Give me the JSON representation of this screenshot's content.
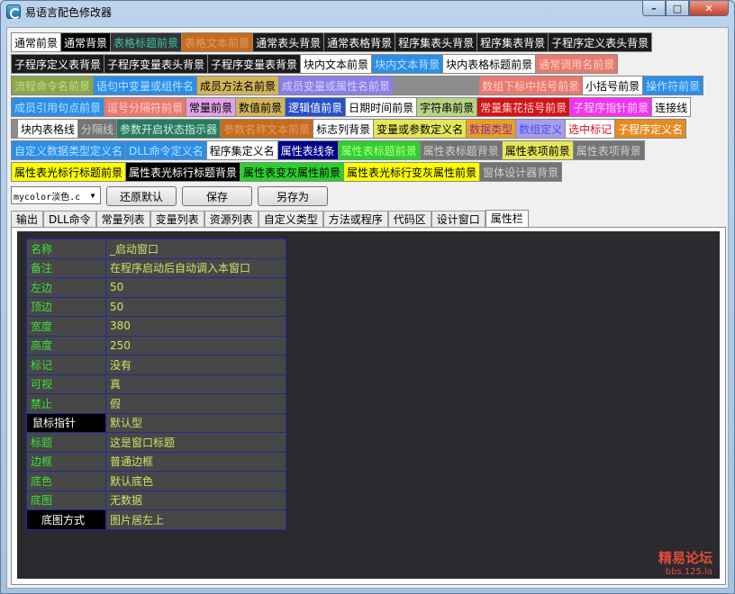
{
  "window": {
    "title": "易语言配色修改器",
    "min": "–",
    "max": "□",
    "close": "✕"
  },
  "swatch_rows": [
    [
      {
        "label": "通常前景",
        "bg": "#ffffff",
        "fg": "#000000"
      },
      {
        "label": "通常背景",
        "bg": "#000000",
        "fg": "#ffffff"
      },
      {
        "label": "表格标题前景",
        "bg": "#333333",
        "fg": "#3cc7a8"
      },
      {
        "label": "表格文本前景",
        "bg": "#c86b1a",
        "fg": "#d8a070"
      },
      {
        "label": "通常表头背景",
        "bg": "#1b1b1b",
        "fg": "#ffffff"
      },
      {
        "label": "通常表格背景",
        "bg": "#1b1b1b",
        "fg": "#ffffff"
      },
      {
        "label": "程序集表头背景",
        "bg": "#1b1b1b",
        "fg": "#ffffff"
      },
      {
        "label": "程序集表背景",
        "bg": "#1b1b1b",
        "fg": "#ffffff"
      },
      {
        "label": "子程序定义表头背景",
        "bg": "#1b1b1b",
        "fg": "#ffffff"
      }
    ],
    [
      {
        "label": "子程序定义表背景",
        "bg": "#1b1b1b",
        "fg": "#ffffff"
      },
      {
        "label": "子程序变量表头背景",
        "bg": "#1b1b1b",
        "fg": "#ffffff"
      },
      {
        "label": "子程序变量表背景",
        "bg": "#1b1b1b",
        "fg": "#ffffff"
      },
      {
        "label": "块内文本前景",
        "bg": "#ffffff",
        "fg": "#000000"
      },
      {
        "label": "块内文本背景",
        "bg": "#2c8ee8",
        "fg": "#b9e1ff"
      },
      {
        "label": "块内表格标题前景",
        "bg": "#ffffff",
        "fg": "#000000"
      },
      {
        "label": "通常调用名前景",
        "bg": "#e87a6e",
        "fg": "#ffd0cc"
      }
    ],
    [
      {
        "label": "流程命令名前景",
        "bg": "#8aa64a",
        "fg": "#c7da8f"
      },
      {
        "label": "语句中变量或组件名",
        "bg": "#2c8ee8",
        "fg": "#b9e1ff"
      },
      {
        "label": "成员方法名前景",
        "bg": "#d2b45c",
        "fg": "#000000"
      },
      {
        "label": "成员变量或属性名前景",
        "bg": "#8a7ee8",
        "fg": "#d7d1ff"
      },
      {
        "label": "",
        "bg": "#8c8c8c",
        "fg": "#000000"
      },
      {
        "label": "数组下标中括号前景",
        "bg": "#e87a6e",
        "fg": "#ffd0cc"
      },
      {
        "label": "小括号前景",
        "bg": "#ffffff",
        "fg": "#000000"
      },
      {
        "label": "操作符前景",
        "bg": "#2c8ee8",
        "fg": "#b9e1ff"
      }
    ],
    [
      {
        "label": "成员引用句点前景",
        "bg": "#2c8ee8",
        "fg": "#b9e1ff"
      },
      {
        "label": "逗号分隔符前景",
        "bg": "#e87a6e",
        "fg": "#ffd0cc"
      },
      {
        "label": "常量前景",
        "bg": "#e0a2e8",
        "fg": "#000000"
      },
      {
        "label": "数值前景",
        "bg": "#d2b45c",
        "fg": "#000000"
      },
      {
        "label": "逻辑值前景",
        "bg": "#2850c8",
        "fg": "#ffffff"
      },
      {
        "label": "日期时间前景",
        "bg": "#ffffff",
        "fg": "#000000"
      },
      {
        "label": "字符串前景",
        "bg": "#b6d484",
        "fg": "#000000"
      },
      {
        "label": "常量集花括号前景",
        "bg": "#d0141e",
        "fg": "#ffd7c0"
      },
      {
        "label": "子程序指针前景",
        "bg": "#f234f2",
        "fg": "#ffe0ff"
      },
      {
        "label": "连接线",
        "bg": "#ffffff",
        "fg": "#000000"
      }
    ],
    [
      {
        "label": "    ",
        "bg": "#8c8c8c",
        "fg": "#000000"
      },
      {
        "label": "块内表格线",
        "bg": "#ffffff",
        "fg": "#000000"
      },
      {
        "label": "分隔线",
        "bg": "#747474",
        "fg": "#cfcfcf"
      },
      {
        "label": "参数开启状态指示器",
        "bg": "#2a7a60",
        "fg": "#d0f0e0"
      },
      {
        "label": "参数名称文本前景",
        "bg": "#c86b1a",
        "fg": "#d8a070"
      },
      {
        "label": "标志列背景",
        "bg": "#ffffff",
        "fg": "#000000"
      },
      {
        "label": "变量或参数定义名",
        "bg": "#e6e65a",
        "fg": "#000000"
      },
      {
        "label": "数据类型",
        "bg": "#e8a024",
        "fg": "#8a2aa0"
      },
      {
        "label": "数组定义",
        "bg": "#a89ee8",
        "fg": "#4a4aff"
      },
      {
        "label": "选中标记",
        "bg": "#ffffff",
        "fg": "#d0141e"
      },
      {
        "label": "子程序定义名",
        "bg": "#e88a20",
        "fg": "#ffffff"
      }
    ],
    [
      {
        "label": "自定义数据类型定义名",
        "bg": "#2c8ee8",
        "fg": "#b9e1ff"
      },
      {
        "label": "DLL命令定义名",
        "bg": "#2c8ee8",
        "fg": "#b9e1ff"
      },
      {
        "label": "程序集定义名",
        "bg": "#ffffff",
        "fg": "#000000"
      },
      {
        "label": "属性表线条",
        "bg": "#000088",
        "fg": "#ffffff"
      },
      {
        "label": "属性表标题前景",
        "bg": "#2cd02c",
        "fg": "#b8ff8a"
      },
      {
        "label": "属性表标题背景",
        "bg": "#747474",
        "fg": "#cfcfcf"
      },
      {
        "label": "属性表项前景",
        "bg": "#e6e65a",
        "fg": "#000000"
      },
      {
        "label": "属性表项背景",
        "bg": "#747474",
        "fg": "#cfcfcf"
      }
    ],
    [
      {
        "label": "属性表光标行标题前景",
        "bg": "#ffff00",
        "fg": "#000000"
      },
      {
        "label": "属性表光标行标题背景",
        "bg": "#000000",
        "fg": "#ffffff"
      },
      {
        "label": "属性表变灰属性前景",
        "bg": "#2cd02c",
        "fg": "#000000"
      },
      {
        "label": "属性表光标行变灰属性前景",
        "bg": "#ffff00",
        "fg": "#000000"
      },
      {
        "label": "窗体设计器背景",
        "bg": "#747474",
        "fg": "#cfcfcf"
      }
    ]
  ],
  "toolbar": {
    "scheme_value": "mycolor淡色.c",
    "restore_label": "还原默认",
    "save_label": "保存",
    "save_as_label": "另存为"
  },
  "tabs": [
    {
      "label": "输出",
      "active": false
    },
    {
      "label": "DLL命令",
      "active": false
    },
    {
      "label": "常量列表",
      "active": false
    },
    {
      "label": "变量列表",
      "active": false
    },
    {
      "label": "资源列表",
      "active": false
    },
    {
      "label": "自定义类型",
      "active": false
    },
    {
      "label": "方法或程序",
      "active": false
    },
    {
      "label": "代码区",
      "active": false
    },
    {
      "label": "设计窗口",
      "active": false
    },
    {
      "label": "属性栏",
      "active": true
    }
  ],
  "properties": [
    {
      "name": "名称",
      "value": "_启动窗口",
      "selected": ""
    },
    {
      "name": "备注",
      "value": "在程序启动后自动调入本窗口",
      "selected": ""
    },
    {
      "name": "左边",
      "value": "50",
      "selected": ""
    },
    {
      "name": "顶边",
      "value": "50",
      "selected": ""
    },
    {
      "name": "宽度",
      "value": "380",
      "selected": ""
    },
    {
      "name": "高度",
      "value": "250",
      "selected": ""
    },
    {
      "name": "标记",
      "value": "没有",
      "selected": ""
    },
    {
      "name": "可视",
      "value": "真",
      "selected": ""
    },
    {
      "name": "禁止",
      "value": "假",
      "selected": ""
    },
    {
      "name": "鼠标指针",
      "value": "默认型",
      "selected": "sel"
    },
    {
      "name": "标题",
      "value": "这是窗口标题",
      "selected": ""
    },
    {
      "name": "边框",
      "value": "普通边框",
      "selected": ""
    },
    {
      "name": "底色",
      "value": "默认底色",
      "selected": ""
    },
    {
      "name": "底图",
      "value": "无数据",
      "selected": ""
    },
    {
      "name": "底图方式",
      "value": "图片居左上",
      "selected": "sel2"
    }
  ],
  "watermark": {
    "line1": "精易论坛",
    "line2": "bbs.125.la"
  }
}
